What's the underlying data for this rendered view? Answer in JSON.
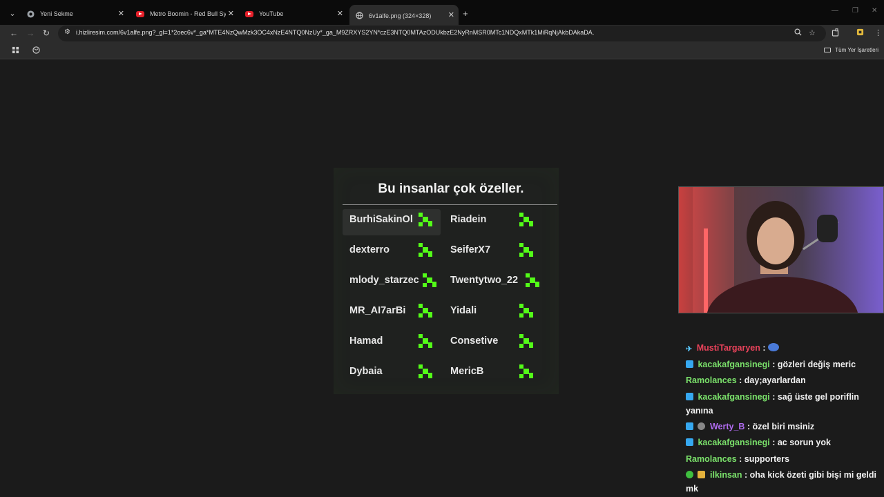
{
  "tabs": [
    {
      "title": "Yeni Sekme",
      "favicon": "chrome-icon"
    },
    {
      "title": "Metro Boomin - Red Bull Symp",
      "favicon": "youtube-icon"
    },
    {
      "title": "YouTube",
      "favicon": "youtube-icon"
    },
    {
      "title": "6v1alfe.png (324×328)",
      "favicon": "globe-icon",
      "active": true
    }
  ],
  "address": {
    "url": "i.hizliresim.com/6v1alfe.png?_gl=1*2oec6v*_ga*MTE4NzQwMzk3OC4xNzE4NTQ0NzUy*_ga_M9ZRXYS2YN*czE3NTQ0MTAzODUkbzE2NyRnMSR0MTc1NDQxMTk1MiRqNjAkbDAkaDA."
  },
  "bookmarks": {
    "all_label": "Tüm Yer İşaretleri"
  },
  "card": {
    "title": "Bu insanlar çok özeller.",
    "left": [
      "BurhiSakinOl",
      "dexterro",
      "mlody_starzec",
      "MR_AI7arBi",
      "Hamad",
      "Dybaia"
    ],
    "right": [
      "Riadein",
      "SeiferX7",
      "Twentytwo_22",
      "Yidali",
      "Consetive",
      "MericB"
    ],
    "accent": "#53fc18"
  },
  "chat": [
    {
      "user": "MustiTargaryen",
      "color": "#e8425a",
      "text": ":"
    },
    {
      "user": "kacakafgansinegi",
      "color": "#7be26b",
      "text": ": gözleri değiş meric"
    },
    {
      "user": "Ramolances",
      "color": "#7be26b",
      "text": ": day;ayarlardan"
    },
    {
      "user": "kacakafgansinegi",
      "color": "#7be26b",
      "text": ": sağ üste gel poriflin yanına"
    },
    {
      "user": "Werty_B",
      "color": "#b06bf0",
      "text": ": özel biri msiniz"
    },
    {
      "user": "kacakafgansinegi",
      "color": "#7be26b",
      "text": ": ac sorun yok"
    },
    {
      "user": "Ramolances",
      "color": "#7be26b",
      "text": ": supporters"
    },
    {
      "user": "ilkinsan",
      "color": "#7be26b",
      "text": ": oha kick özeti gibi bişi mi geldi mk"
    }
  ]
}
